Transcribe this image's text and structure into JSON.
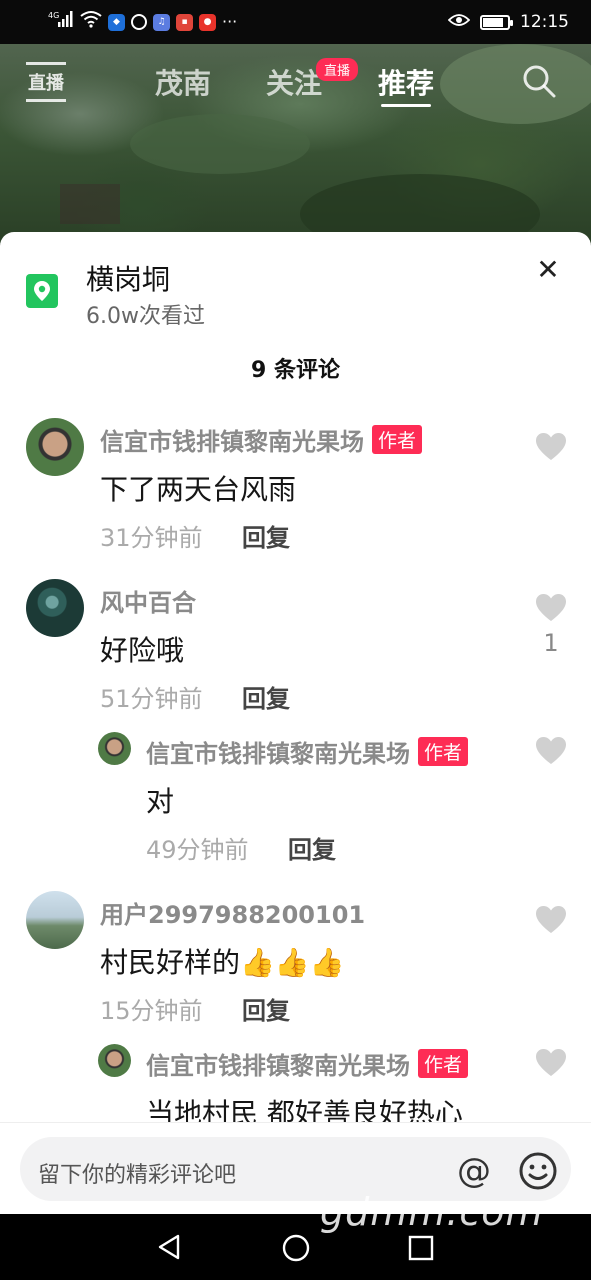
{
  "statusbar": {
    "signal": "4G",
    "time": "12:15",
    "battery_level": 0.85
  },
  "topnav": {
    "live_label": "直播",
    "tabs": [
      {
        "label": "茂南"
      },
      {
        "label": "关注"
      },
      {
        "label": "推荐"
      }
    ],
    "live_badge": "直播",
    "active_tab": "推荐"
  },
  "sheet": {
    "location": {
      "title": "横岗垌",
      "views": "6.0w次看过"
    },
    "comment_count": "9 条评论",
    "comments": [
      {
        "name": "信宜市钱排镇黎南光果场",
        "tag": "作者",
        "text": "下了两天台风雨",
        "time": "31分钟前",
        "reply": "回复",
        "likes": ""
      },
      {
        "name": "风中百合",
        "tag": "",
        "text": "好险哦",
        "time": "51分钟前",
        "reply": "回复",
        "likes": "1"
      },
      {
        "name": "信宜市钱排镇黎南光果场",
        "tag": "作者",
        "text": "对",
        "time": "49分钟前",
        "reply": "回复",
        "likes": ""
      },
      {
        "name": "用户2997988200101",
        "tag": "",
        "text": "村民好样的",
        "emoji": "👍👍👍",
        "time": "15分钟前",
        "reply": "回复",
        "likes": ""
      },
      {
        "name": "信宜市钱排镇黎南光果场",
        "tag": "作者",
        "text": "当地村民 都好善良好热心",
        "time": "",
        "reply": "",
        "likes": ""
      }
    ]
  },
  "input": {
    "placeholder": "留下你的精彩评论吧",
    "at_symbol": "@"
  },
  "watermark": "gdmm.com",
  "colors": {
    "accent": "#fe2c55",
    "location_green": "#22c55e"
  }
}
